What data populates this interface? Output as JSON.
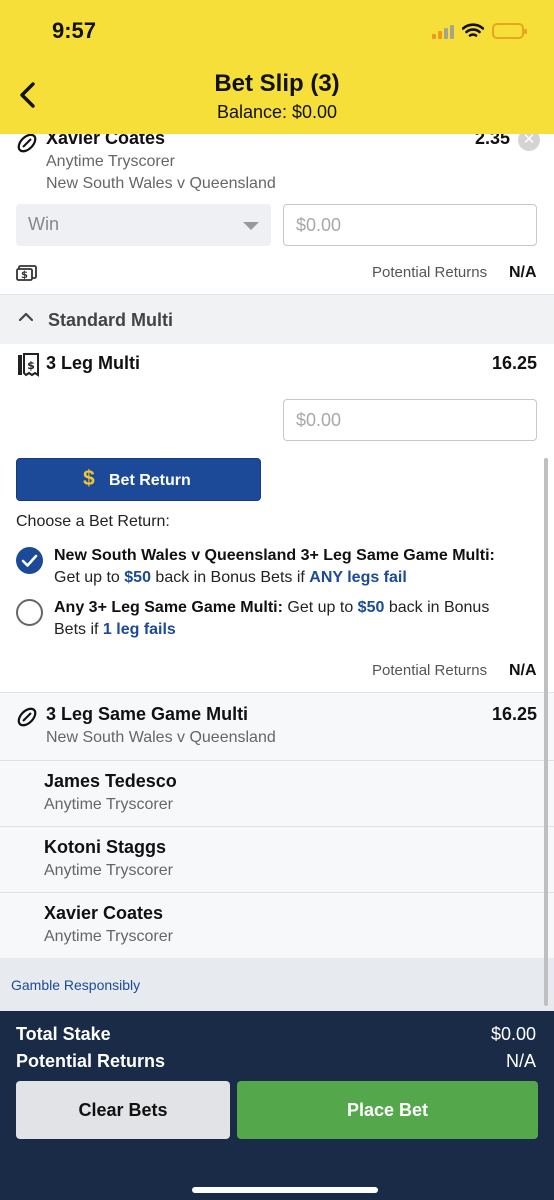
{
  "status_bar": {
    "time": "9:57"
  },
  "header": {
    "title": "Bet Slip (3)",
    "balance": "Balance: $0.00"
  },
  "single_bet": {
    "selection": "Xavier Coates",
    "market": "Anytime Tryscorer",
    "event": "New South Wales v Queensland",
    "odds": "2.35",
    "bet_type": "Win",
    "stake_placeholder": "$0.00",
    "potential_returns_label": "Potential Returns",
    "potential_returns_value": "N/A"
  },
  "standard_multi": {
    "section_label": "Standard Multi",
    "title": "3 Leg Multi",
    "odds": "16.25",
    "stake_placeholder": "$0.00",
    "bet_return_button": "Bet Return",
    "choose_label": "Choose a Bet Return:",
    "option1": {
      "heading": "New South Wales v Queensland 3+ Leg Same Game Multi:",
      "text_a": "Get up to ",
      "amount": "$50",
      "text_b": " back in Bonus Bets if ",
      "condition": "ANY legs fail",
      "selected": true
    },
    "option2": {
      "heading": "Any 3+ Leg Same Game Multi:",
      "text_a": " Get up to ",
      "amount": "$50",
      "text_b": " back in Bonus Bets if ",
      "condition": "1 leg fails",
      "selected": false
    },
    "potential_returns_label": "Potential Returns",
    "potential_returns_value": "N/A"
  },
  "same_game_multi": {
    "title": "3 Leg Same Game Multi",
    "event": "New South Wales v Queensland",
    "odds": "16.25",
    "legs": [
      {
        "name": "James Tedesco",
        "market": "Anytime Tryscorer"
      },
      {
        "name": "Kotoni Staggs",
        "market": "Anytime Tryscorer"
      },
      {
        "name": "Xavier Coates",
        "market": "Anytime Tryscorer"
      }
    ]
  },
  "gamble_link": "Gamble Responsibly",
  "footer": {
    "total_stake_label": "Total Stake",
    "total_stake_value": "$0.00",
    "potential_returns_label": "Potential Returns",
    "potential_returns_value": "N/A",
    "clear_button": "Clear Bets",
    "place_button": "Place Bet"
  },
  "colors": {
    "header": "#f7df3a",
    "brand_blue": "#1c4a98",
    "place_green": "#54a74a",
    "footer_navy": "#1a2b48"
  },
  "icons": [
    "back-chevron-icon",
    "rugby-ball-icon",
    "close-icon",
    "dropdown-caret-icon",
    "cash-out-icon",
    "collapse-chevron-icon",
    "multi-receipt-icon",
    "dollar-icon",
    "checkmark-icon"
  ]
}
